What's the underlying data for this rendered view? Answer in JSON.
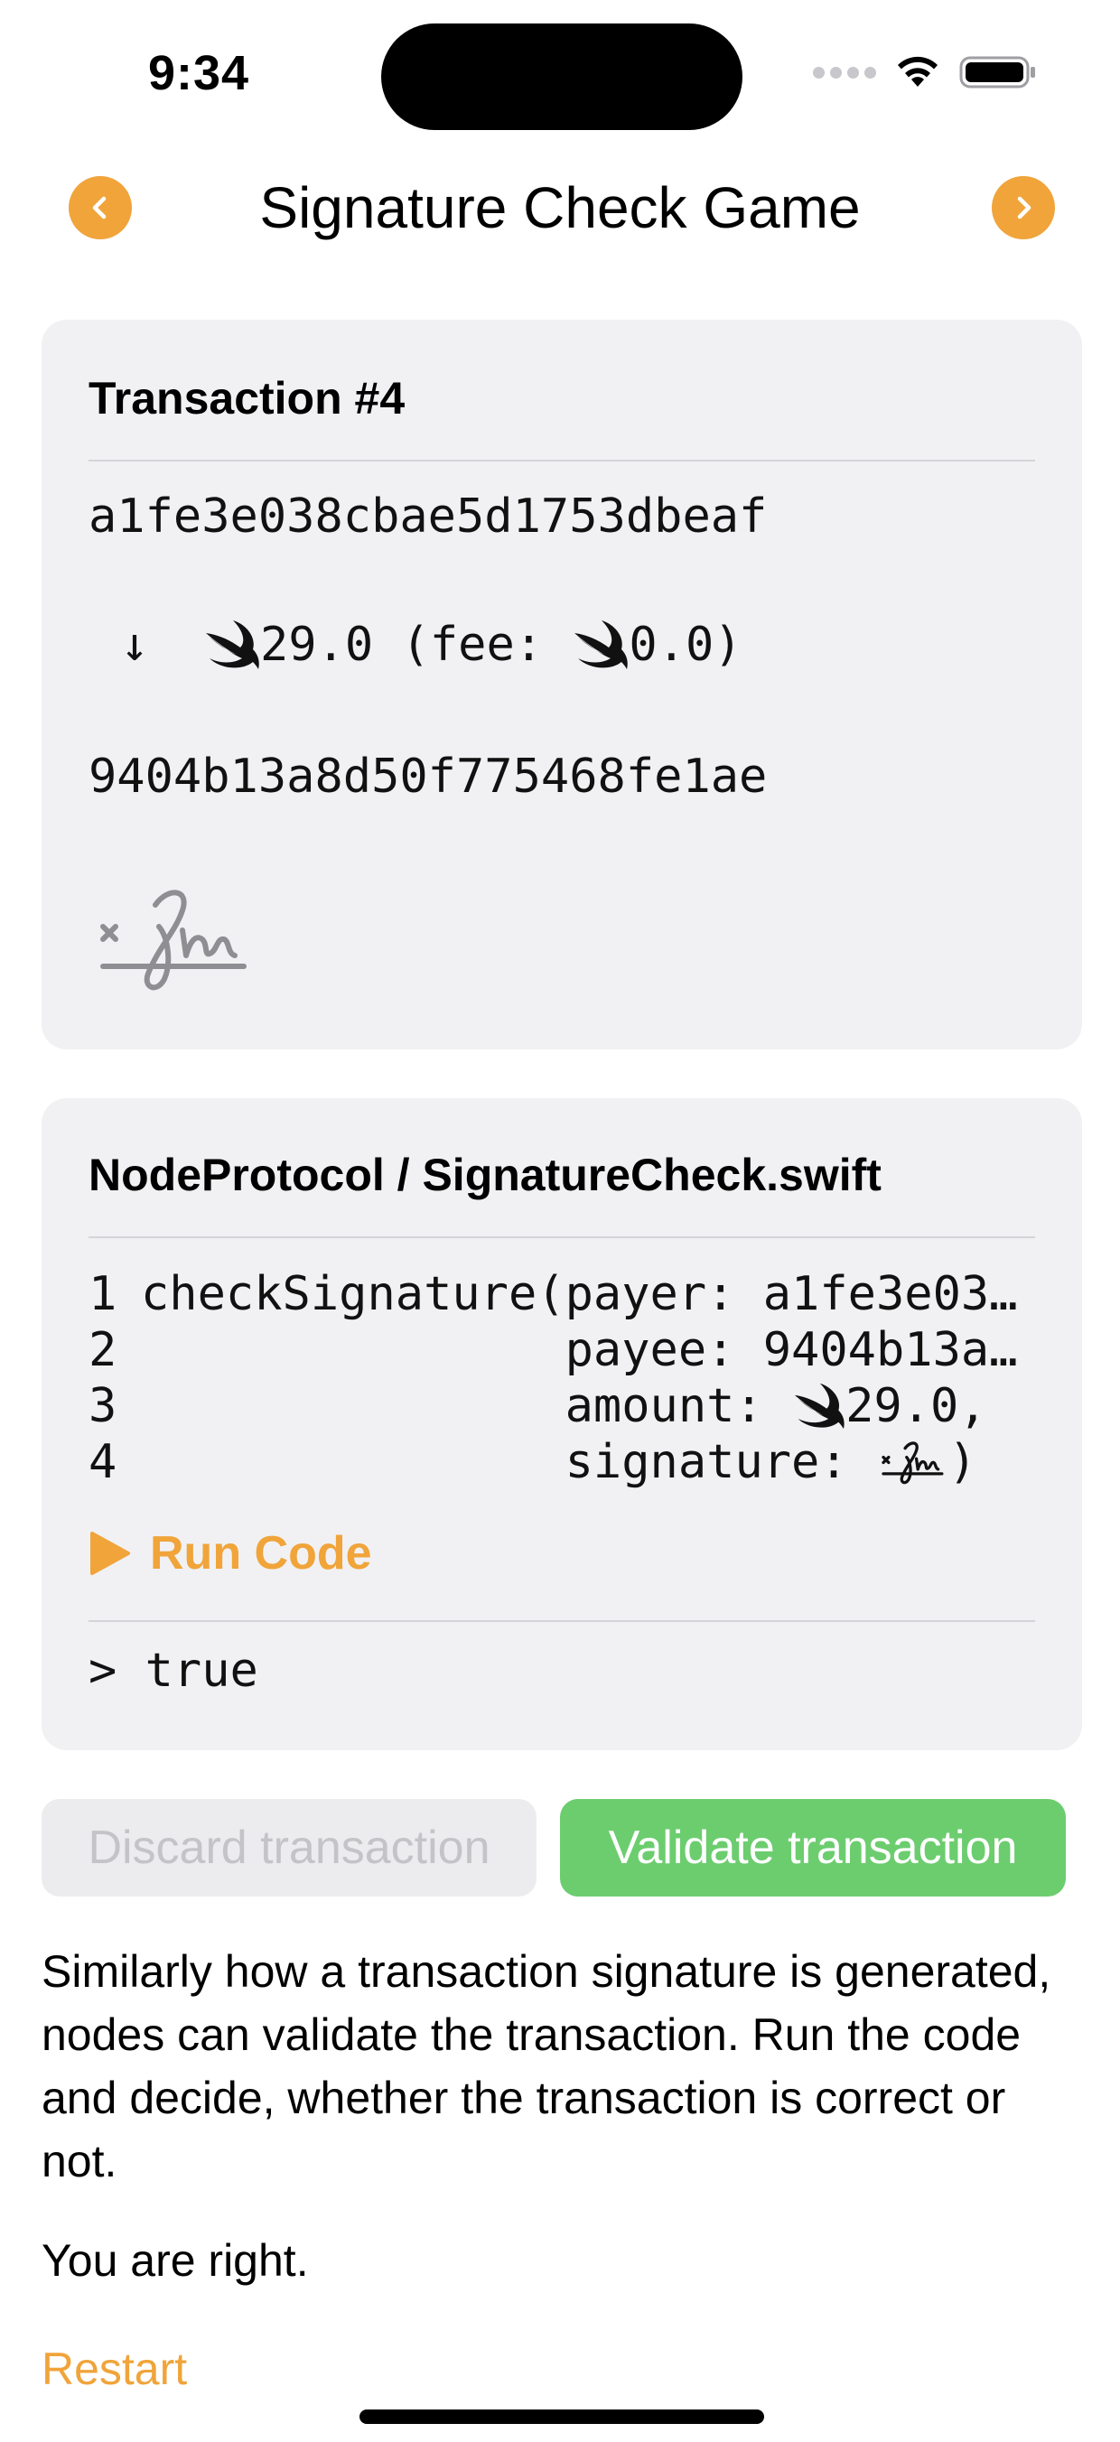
{
  "status_bar": {
    "time": "9:34",
    "icons": [
      "signal-dots-icon",
      "wifi-icon",
      "battery-icon"
    ]
  },
  "nav": {
    "title": "Signature Check Game",
    "prev_icon": "chevron-left-icon",
    "next_icon": "chevron-right-icon"
  },
  "transaction": {
    "title": "Transaction #4",
    "payer": "a1fe3e038cbae5d1753dbeaf",
    "amount": "29.0",
    "fee_prefix": " (fee: ",
    "fee": "0.0)",
    "payee": "9404b13a8d50f775468fe1ae",
    "arrow": "↓",
    "currency_icon": "swift-icon",
    "signature_icon": "signature-icon"
  },
  "code": {
    "title": "NodeProtocol / SignatureCheck.swift",
    "lines": [
      {
        "num": "1",
        "text": "checkSignature(payer: a1fe3e03…"
      },
      {
        "num": "2",
        "text": "               payee: 9404b13a…"
      },
      {
        "num": "3",
        "prefix": "               amount: ",
        "suffix": "29.0,"
      },
      {
        "num": "4",
        "prefix": "               signature: ",
        "suffix": ")"
      }
    ],
    "run_label": "Run Code",
    "output": "> true"
  },
  "actions": {
    "discard_label": "Discard transaction",
    "validate_label": "Validate transaction"
  },
  "description": "Similarly how a transaction signature is generated, nodes can validate the transaction. Run the code and decide, whether the transaction is correct or not.",
  "result": "You are right.",
  "restart_label": "Restart",
  "colors": {
    "accent": "#f0a43a",
    "validate": "#6ccd6f",
    "card_bg": "#f1f1f3"
  }
}
